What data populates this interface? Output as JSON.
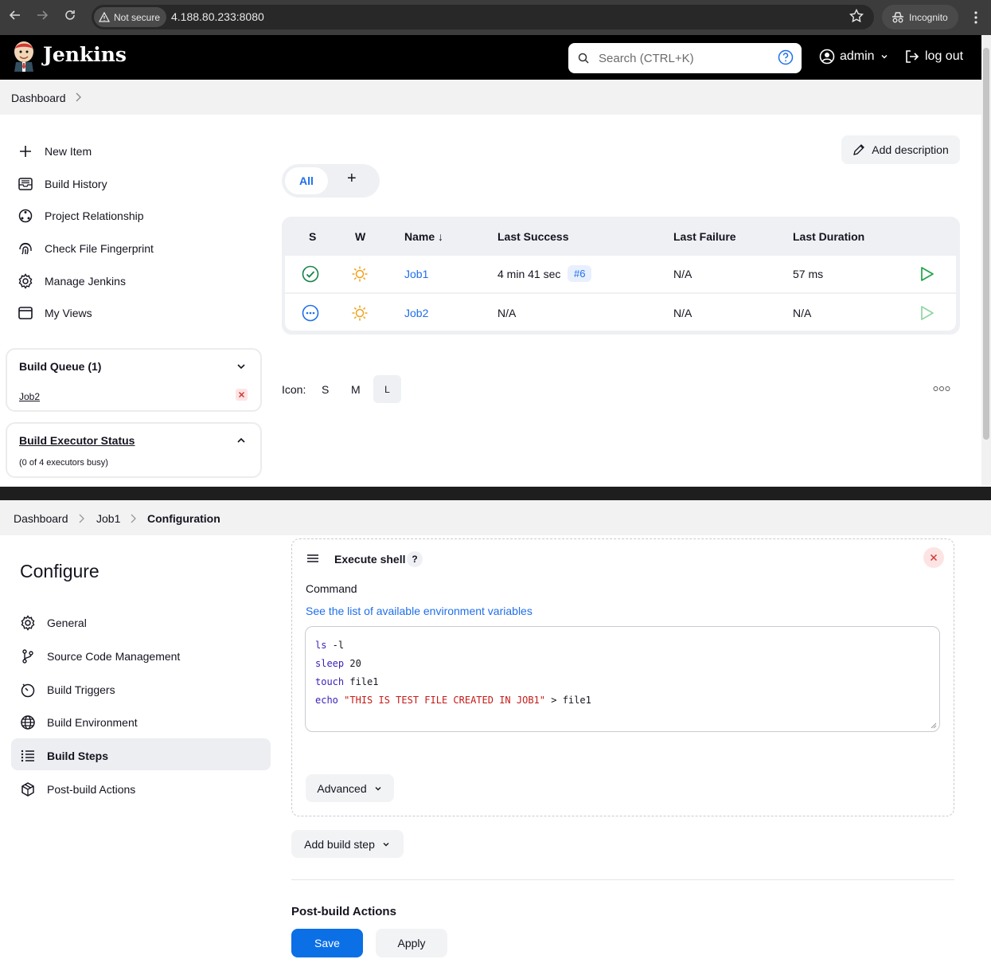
{
  "browser": {
    "not_secure": "Not secure",
    "url": "4.188.80.233:8080",
    "incognito": "Incognito"
  },
  "header": {
    "brand": "Jenkins",
    "search_placeholder": "Search (CTRL+K)",
    "user": "admin",
    "logout": "log out"
  },
  "top_breadcrumb": {
    "dashboard": "Dashboard"
  },
  "tasks": [
    {
      "label": "New Item",
      "icon": "plus-icon"
    },
    {
      "label": "Build History",
      "icon": "inbox-icon"
    },
    {
      "label": "Project Relationship",
      "icon": "relationship-icon"
    },
    {
      "label": "Check File Fingerprint",
      "icon": "fingerprint-icon"
    },
    {
      "label": "Manage Jenkins",
      "icon": "gear-icon"
    },
    {
      "label": "My Views",
      "icon": "window-icon"
    }
  ],
  "build_queue": {
    "title": "Build Queue (1)",
    "item": "Job2"
  },
  "executor": {
    "title": "Build Executor Status",
    "subtitle": "(0 of 4 executors busy)"
  },
  "add_description": "Add description",
  "views": {
    "all": "All",
    "add": "+"
  },
  "table": {
    "headers": [
      "S",
      "W",
      "Name ↓",
      "Last Success",
      "Last Failure",
      "Last Duration"
    ],
    "rows": [
      {
        "name": "Job1",
        "last_success": "4 min 41 sec",
        "build": "#6",
        "last_failure": "N/A",
        "last_duration": "57 ms",
        "status": "success"
      },
      {
        "name": "Job2",
        "last_success": "N/A",
        "build": "",
        "last_failure": "N/A",
        "last_duration": "N/A",
        "status": "pending"
      }
    ]
  },
  "icon_size": {
    "label": "Icon:",
    "s": "S",
    "m": "M",
    "l": "L",
    "selected": "L"
  },
  "config_breadcrumb": {
    "dashboard": "Dashboard",
    "job": "Job1",
    "page": "Configuration"
  },
  "configure": {
    "title": "Configure",
    "sections": [
      {
        "label": "General",
        "icon": "gear-icon"
      },
      {
        "label": "Source Code Management",
        "icon": "branch-icon"
      },
      {
        "label": "Build Triggers",
        "icon": "timer-icon"
      },
      {
        "label": "Build Environment",
        "icon": "globe-icon"
      },
      {
        "label": "Build Steps",
        "icon": "list-icon",
        "active": true
      },
      {
        "label": "Post-build Actions",
        "icon": "box-icon"
      }
    ]
  },
  "shell_step": {
    "title": "Execute shell",
    "help": "?",
    "command_label": "Command",
    "see_prefix": "See ",
    "see_link": "the list of available environment variables",
    "code": [
      [
        "ls",
        " -l"
      ],
      [
        "sleep",
        " 20"
      ],
      [
        "touch",
        " file1"
      ],
      [
        "echo",
        " ",
        "\"THIS IS TEST FILE CREATED IN JOB1\"",
        " > file1"
      ]
    ],
    "advanced": "Advanced"
  },
  "add_build_step": "Add build step",
  "post_build_heading": "Post-build Actions",
  "buttons": {
    "save": "Save",
    "apply": "Apply"
  }
}
